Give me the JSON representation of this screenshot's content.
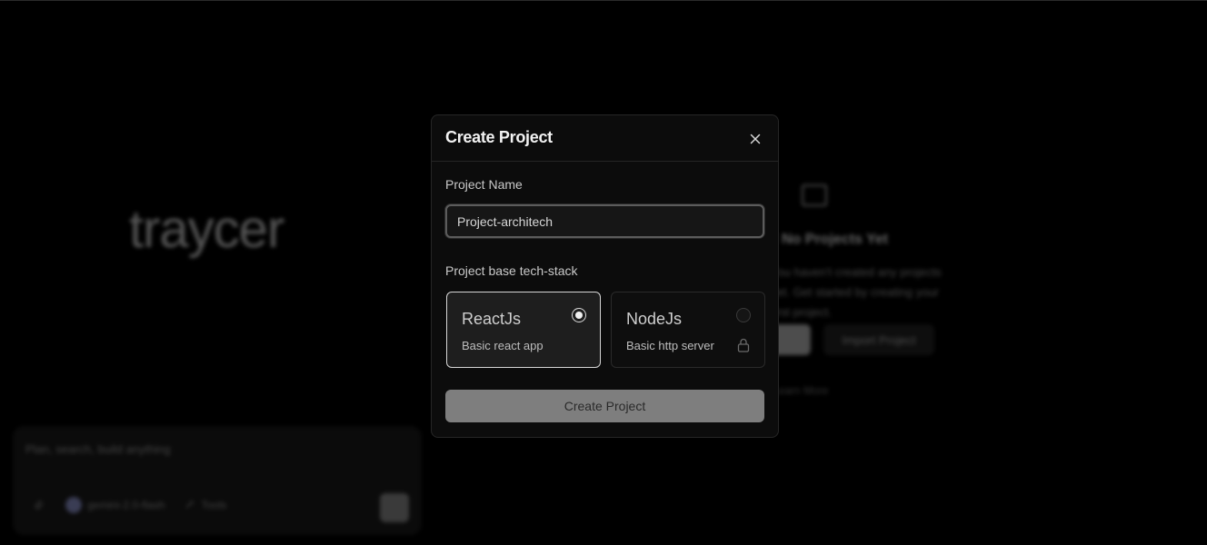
{
  "background": {
    "brand": "traycer",
    "chat": {
      "placeholder": "Plan, search, build anything",
      "model": "gemini-2.0-flash",
      "tools": "Tools"
    },
    "empty_state": {
      "title": "No Projects Yet",
      "description": "You haven't created any projects yet. Get started by creating your first project.",
      "import_label": "Import Project",
      "link_label": "Learn More"
    }
  },
  "modal": {
    "title": "Create Project",
    "name_label": "Project Name",
    "name_value": "Project-architech",
    "stack_label": "Project base tech-stack",
    "stacks": [
      {
        "title": "ReactJs",
        "description": "Basic react app",
        "selected": true,
        "locked": false
      },
      {
        "title": "NodeJs",
        "description": "Basic http server",
        "selected": false,
        "locked": true
      }
    ],
    "submit_label": "Create Project"
  },
  "colors": {
    "background": "#000000",
    "modal_bg": "#0c0c0c",
    "border": "#262626",
    "submit_bg": "#7e7e7e"
  },
  "icons": {
    "close": "close-icon",
    "lock": "lock-icon",
    "folder": "folder-icon"
  }
}
